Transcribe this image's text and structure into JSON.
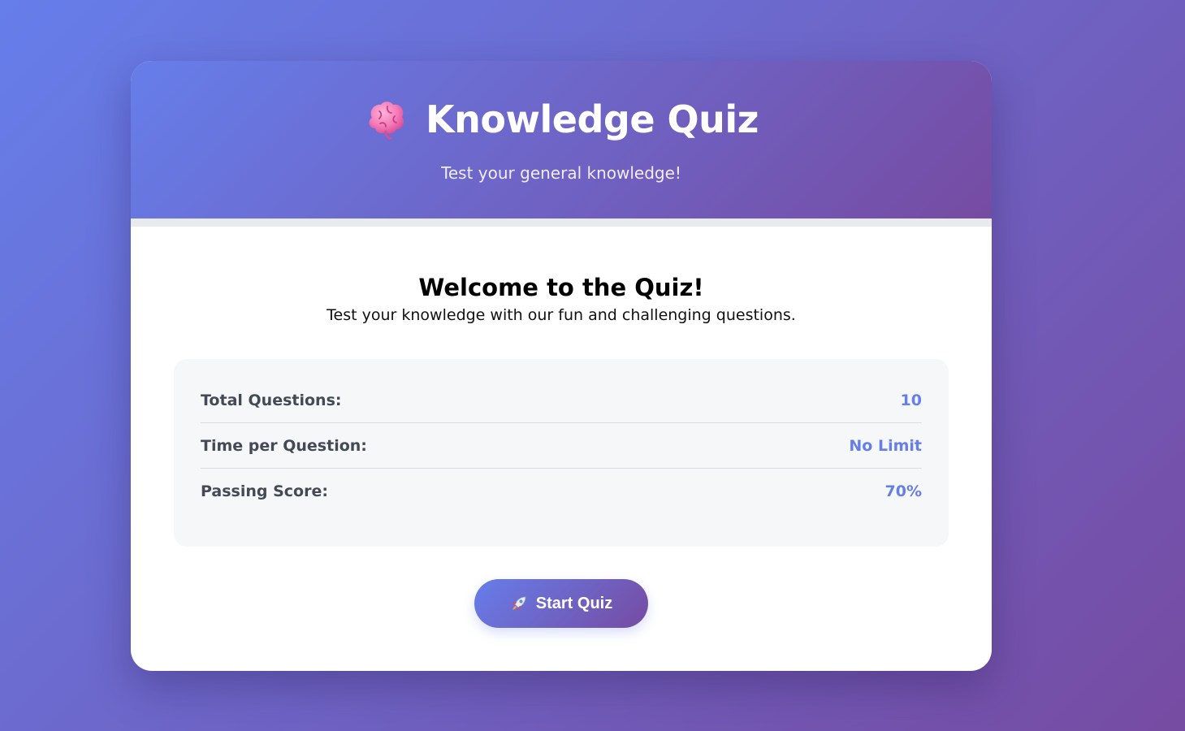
{
  "header": {
    "icon": "brain-icon",
    "title": "Knowledge Quiz",
    "subtitle": "Test your general knowledge!"
  },
  "welcome": {
    "title": "Welcome to the Quiz!",
    "text": "Test your knowledge with our fun and challenging questions."
  },
  "info": [
    {
      "label": "Total Questions:",
      "value": "10"
    },
    {
      "label": "Time per Question:",
      "value": "No Limit"
    },
    {
      "label": "Passing Score:",
      "value": "70%"
    }
  ],
  "start_button": {
    "icon": "rocket-icon",
    "label": "Start Quiz"
  },
  "colors": {
    "gradient_start": "#667eea",
    "gradient_end": "#764ba2",
    "accent": "#667eea"
  }
}
